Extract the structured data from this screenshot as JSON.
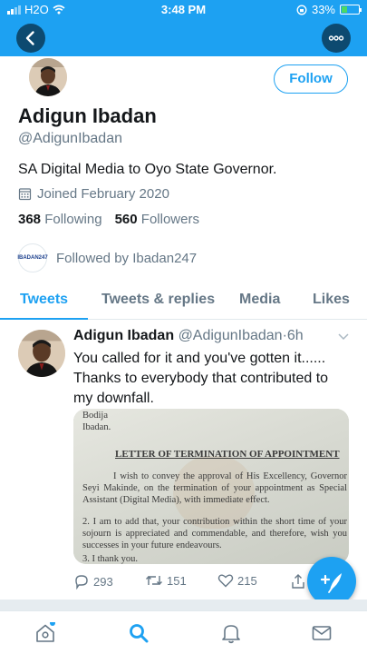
{
  "status_bar": {
    "carrier": "H2O",
    "time": "3:48 PM",
    "battery": "33%",
    "battery_level": 0.33
  },
  "header": {
    "back_icon": "chevron-left-icon",
    "more_icon": "more-horizontal-icon"
  },
  "profile": {
    "follow_label": "Follow",
    "name": "Adigun Ibadan",
    "handle": "@AdigunIbadan",
    "bio": "SA Digital Media to Oyo State Governor.",
    "joined": "Joined February 2020",
    "following_count": "368",
    "following_label": "Following",
    "followers_count": "560",
    "followers_label": "Followers",
    "followed_by": "Followed by Ibadan247",
    "followed_by_badge": "IBADAN247"
  },
  "tabs": [
    {
      "label": "Tweets"
    },
    {
      "label": "Tweets & replies"
    },
    {
      "label": "Media"
    },
    {
      "label": "Likes"
    }
  ],
  "tweet": {
    "author_name": "Adigun Ibadan",
    "author_handle": "@AdigunIbadan",
    "separator": "·",
    "age": "6h",
    "text": "You called for it and you've gotten it...... Thanks to everybody that contributed to my downfall.",
    "media": {
      "from_line1": "Bodija",
      "from_line2": "Ibadan.",
      "title": "LETTER OF TERMINATION OF APPOINTMENT",
      "paragraph1": "I wish to convey the approval of His Excellency, Governor Seyi Makinde, on the termination of your appointment as Special Assistant (Digital Media), with immediate effect.",
      "paragraph2": "2.     I am to add that, your contribution within the short time of your sojourn is appreciated and commendable, and therefore, wish you successes in your future endeavours.",
      "paragraph3": "3.     I thank you."
    },
    "replies": "293",
    "retweets": "151",
    "likes": "215"
  },
  "colors": {
    "brand": "#1da1f2",
    "header_button": "#0d4a70",
    "secondary_text": "#657786"
  }
}
